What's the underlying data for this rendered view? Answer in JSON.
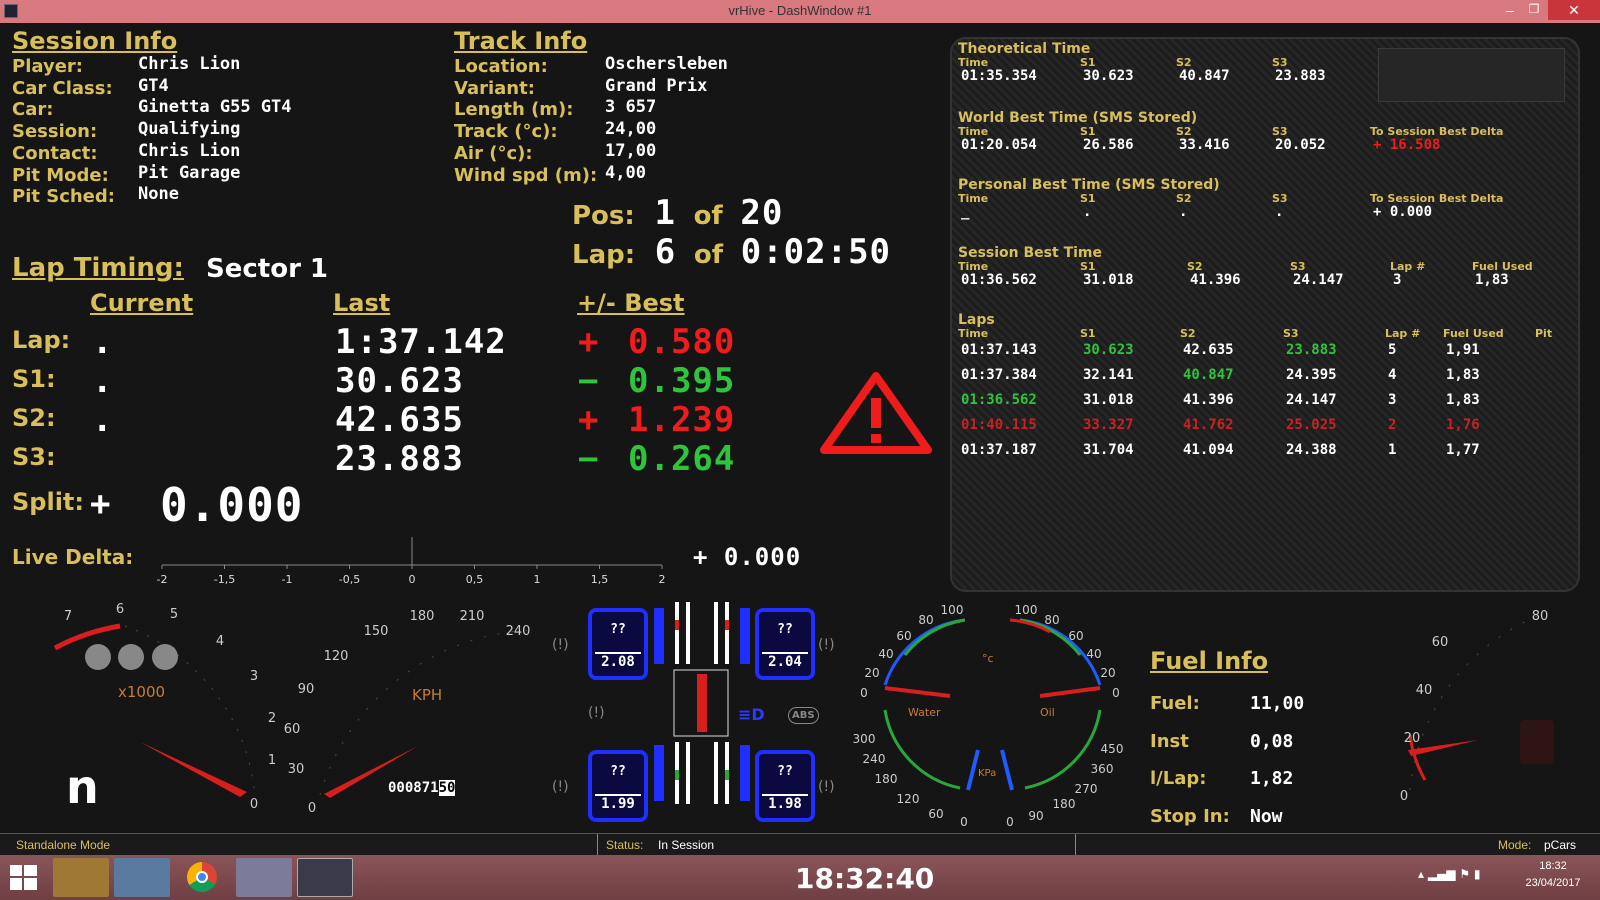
{
  "window": {
    "title": "vrHive - DashWindow #1"
  },
  "session": {
    "heading": "Session Info",
    "rows": [
      {
        "label": "Player:",
        "value": "Chris Lion"
      },
      {
        "label": "Car Class:",
        "value": "GT4"
      },
      {
        "label": "Car:",
        "value": "Ginetta G55 GT4"
      },
      {
        "label": "Session:",
        "value": "Qualifying"
      },
      {
        "label": "Contact:",
        "value": "Chris Lion"
      },
      {
        "label": "Pit Mode:",
        "value": "Pit Garage"
      },
      {
        "label": "Pit Sched:",
        "value": "None"
      }
    ]
  },
  "track": {
    "heading": "Track Info",
    "rows": [
      {
        "label": "Location:",
        "value": "Oschersleben"
      },
      {
        "label": "Variant:",
        "value": "Grand Prix"
      },
      {
        "label": "Length (m):",
        "value": "3 657"
      },
      {
        "label": "Track (°c):",
        "value": "24,00"
      },
      {
        "label": "Air (°c):",
        "value": "17,00"
      },
      {
        "label": "Wind spd (m):",
        "value": "4,00"
      }
    ]
  },
  "position": {
    "pos_label": "Pos:",
    "pos": "1",
    "of": "of",
    "total": "20",
    "lap_label": "Lap:",
    "lap": "6",
    "lap_of": "of",
    "time_left": "0:02:50"
  },
  "lap_timing": {
    "heading": "Lap Timing:",
    "sector": "Sector 1",
    "col_current": "Current",
    "col_last": "Last",
    "col_best": "+/- Best",
    "rows": [
      {
        "label": "Lap:",
        "current": ".",
        "last": "1:37.142",
        "sign": "+",
        "delta": "0.580",
        "color": "#f01c1c"
      },
      {
        "label": "S1:",
        "current": ".",
        "last": "30.623",
        "sign": "−",
        "delta": "0.395",
        "color": "#2ec53c"
      },
      {
        "label": "S2:",
        "current": ".",
        "last": "42.635",
        "sign": "+",
        "delta": "1.239",
        "color": "#f01c1c"
      },
      {
        "label": "S3:",
        "current": "",
        "last": "23.883",
        "sign": "−",
        "delta": "0.264",
        "color": "#2ec53c"
      }
    ],
    "split_label": "Split:",
    "split_sign": "+",
    "split": "0.000",
    "live_label": "Live Delta:",
    "live_value": "+ 0.000",
    "live_ticks": [
      "-2",
      "-1,5",
      "-1",
      "-0,5",
      "0",
      "0,5",
      "1",
      "1,5",
      "2"
    ]
  },
  "times": {
    "theoretical": {
      "title": "Theoretical Time",
      "cols": [
        "Time",
        "S1",
        "S2",
        "S3"
      ],
      "vals": [
        "01:35.354",
        "30.623",
        "40.847",
        "23.883"
      ]
    },
    "world": {
      "title": "World Best Time (SMS Stored)",
      "cols": [
        "Time",
        "S1",
        "S2",
        "S3",
        "To Session Best Delta"
      ],
      "vals": [
        "01:20.054",
        "26.586",
        "33.416",
        "20.052",
        "+ 16.508"
      ]
    },
    "personal": {
      "title": "Personal Best Time (SMS Stored)",
      "cols": [
        "Time",
        "S1",
        "S2",
        "S3",
        "To Session Best Delta"
      ],
      "vals": [
        "_",
        ".",
        ".",
        ".",
        "+ 0.000"
      ]
    },
    "session_best": {
      "title": "Session Best Time",
      "cols": [
        "Time",
        "S1",
        "S2",
        "S3",
        "Lap #",
        "Fuel Used"
      ],
      "vals": [
        "01:36.562",
        "31.018",
        "41.396",
        "24.147",
        "3",
        "1,83"
      ]
    },
    "laps": {
      "title": "Laps",
      "cols": [
        "Time",
        "S1",
        "S2",
        "S3",
        "Lap #",
        "Fuel Used",
        "Pit"
      ],
      "rows": [
        {
          "c": [
            "01:37.143",
            "30.623",
            "42.635",
            "23.883",
            "5",
            "1,91"
          ],
          "k": [
            "w",
            "g",
            "w",
            "g",
            "w",
            "w"
          ]
        },
        {
          "c": [
            "01:37.384",
            "32.141",
            "40.847",
            "24.395",
            "4",
            "1,83"
          ],
          "k": [
            "w",
            "w",
            "g",
            "w",
            "w",
            "w"
          ]
        },
        {
          "c": [
            "01:36.562",
            "31.018",
            "41.396",
            "24.147",
            "3",
            "1,83"
          ],
          "k": [
            "g",
            "w",
            "w",
            "w",
            "w",
            "w"
          ]
        },
        {
          "c": [
            "01:40.115",
            "33.327",
            "41.762",
            "25.025",
            "2",
            "1,76"
          ],
          "k": [
            "r",
            "r",
            "r",
            "r",
            "r",
            "r"
          ]
        },
        {
          "c": [
            "01:37.187",
            "31.704",
            "41.094",
            "24.388",
            "1",
            "1,77"
          ],
          "k": [
            "w",
            "w",
            "w",
            "w",
            "w",
            "w"
          ]
        }
      ]
    }
  },
  "rpm": {
    "ticks": [
      "7",
      "6",
      "5",
      "4",
      "3",
      "2",
      "1",
      "0"
    ],
    "unit": "x1000",
    "gear": "n"
  },
  "speed": {
    "ticks": [
      "240",
      "210",
      "180",
      "150",
      "120",
      "90",
      "60",
      "30",
      "0"
    ],
    "unit": "KPH",
    "odometer": "000871",
    "odo_dec": "50"
  },
  "tires": {
    "fl": {
      "temp": "??",
      "pressure": "2.08"
    },
    "fr": {
      "temp": "??",
      "pressure": "2.04"
    },
    "rl": {
      "temp": "??",
      "pressure": "1.99"
    },
    "rr": {
      "temp": "??",
      "pressure": "1.98"
    }
  },
  "temp_gauge": {
    "water": "Water",
    "oil": "Oil",
    "unit": "°c",
    "left_ticks": [
      "100",
      "80",
      "60",
      "40",
      "20",
      "0"
    ],
    "right_ticks": [
      "100",
      "80",
      "60",
      "40",
      "20",
      "0"
    ]
  },
  "press_gauge": {
    "unit": "KPa",
    "left_ticks": [
      "300",
      "240",
      "180",
      "120",
      "60",
      "0"
    ],
    "right_ticks": [
      "450",
      "360",
      "270",
      "180",
      "90",
      "0"
    ]
  },
  "fuel": {
    "heading": "Fuel Info",
    "rows": [
      {
        "label": "Fuel:",
        "value": "11,00"
      },
      {
        "label": "Inst",
        "value": "0,08"
      },
      {
        "label": "l/Lap:",
        "value": "1,82"
      },
      {
        "label": "Stop In:",
        "value": "Now"
      }
    ],
    "ticks": [
      "80",
      "60",
      "40",
      "20",
      "0"
    ]
  },
  "status": {
    "mode": "Standalone Mode",
    "status_label": "Status:",
    "status": "In Session",
    "mode_label": "Mode:",
    "game": "pCars"
  },
  "taskbar": {
    "clock": "18:32:40",
    "time": "18:32",
    "date": "23/04/2017"
  }
}
